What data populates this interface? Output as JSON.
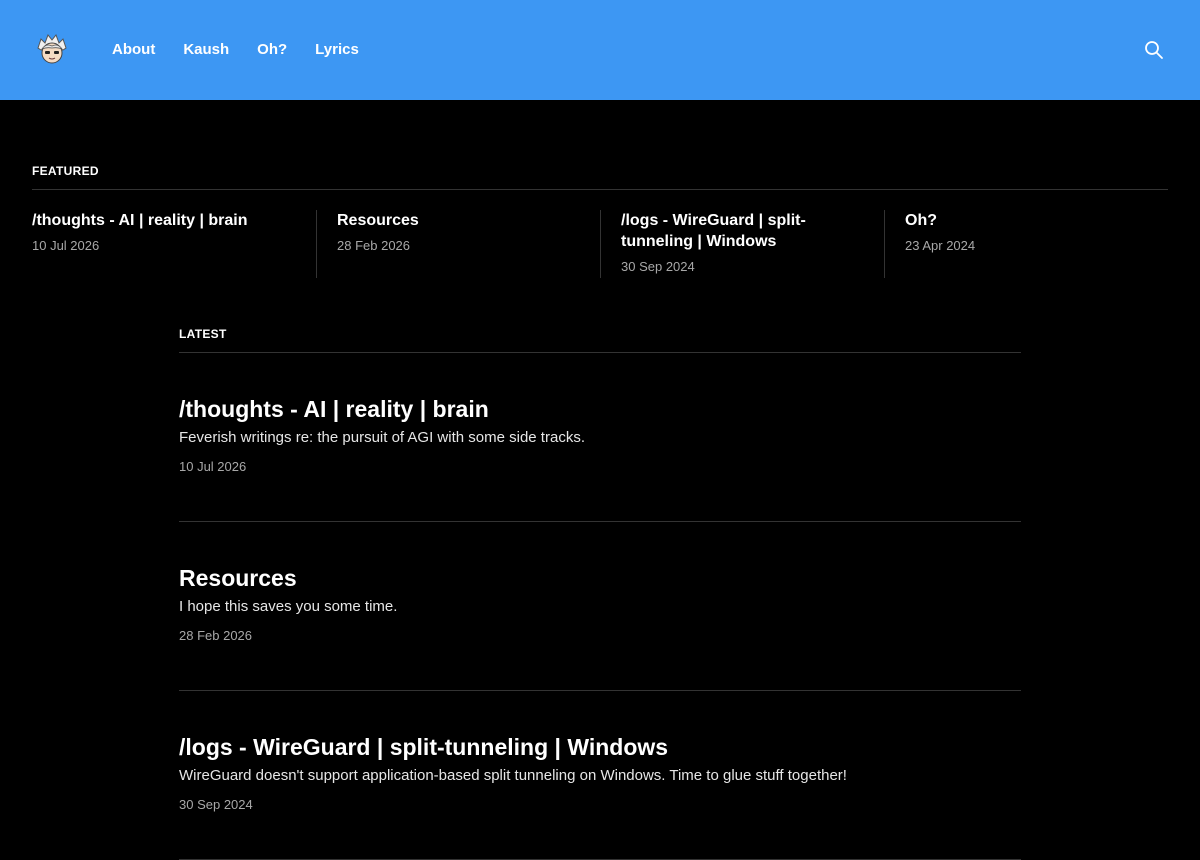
{
  "header": {
    "nav": [
      "About",
      "Kaush",
      "Oh?",
      "Lyrics"
    ],
    "bg_color": "#3d97f3"
  },
  "featured": {
    "label": "FEATURED",
    "items": [
      {
        "title": "/thoughts - AI | reality | brain",
        "date": "10 Jul 2026"
      },
      {
        "title": "Resources",
        "date": "28 Feb 2026"
      },
      {
        "title": "/logs - WireGuard | split-tunneling | Windows",
        "date": "30 Sep 2024"
      },
      {
        "title": "Oh?",
        "date": "23 Apr 2024"
      }
    ]
  },
  "latest": {
    "label": "LATEST",
    "posts": [
      {
        "title": "/thoughts - AI | reality | brain",
        "excerpt": "Feverish writings re: the pursuit of AGI with some side tracks.",
        "date": "10 Jul 2026"
      },
      {
        "title": "Resources",
        "excerpt": "I hope this saves you some time.",
        "date": "28 Feb 2026"
      },
      {
        "title": "/logs - WireGuard | split-tunneling | Windows",
        "excerpt": "WireGuard doesn't support application-based split tunneling on Windows. Time to glue stuff together!",
        "date": "30 Sep 2024"
      }
    ]
  }
}
